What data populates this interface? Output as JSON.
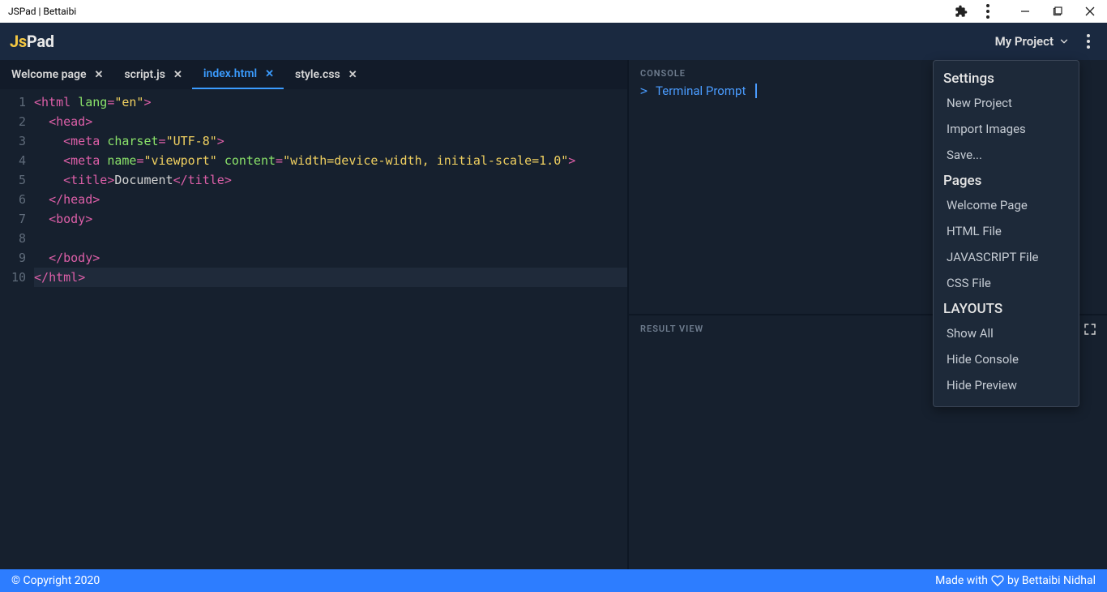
{
  "window": {
    "title": "JSPad | Bettaibi"
  },
  "header": {
    "logo_prefix": "Js",
    "logo_suffix": "Pad",
    "project_label": "My Project"
  },
  "tabs": [
    {
      "label": "Welcome page",
      "active": false
    },
    {
      "label": "script.js",
      "active": false
    },
    {
      "label": "index.html",
      "active": true
    },
    {
      "label": "style.css",
      "active": false
    }
  ],
  "editor": {
    "line_count": 10,
    "current_line_index": 9,
    "lines": [
      {
        "segments": [
          {
            "cls": "t-punc",
            "t": "<"
          },
          {
            "cls": "t-tag",
            "t": "html"
          },
          {
            "cls": "t-text",
            "t": " "
          },
          {
            "cls": "t-attr",
            "t": "lang"
          },
          {
            "cls": "t-punc",
            "t": "="
          },
          {
            "cls": "t-str",
            "t": "\"en\""
          },
          {
            "cls": "t-punc",
            "t": ">"
          }
        ],
        "indent": 0
      },
      {
        "segments": [
          {
            "cls": "t-punc",
            "t": "<"
          },
          {
            "cls": "t-tag",
            "t": "head"
          },
          {
            "cls": "t-punc",
            "t": ">"
          }
        ],
        "indent": 1
      },
      {
        "segments": [
          {
            "cls": "t-punc",
            "t": "<"
          },
          {
            "cls": "t-tag",
            "t": "meta"
          },
          {
            "cls": "t-text",
            "t": " "
          },
          {
            "cls": "t-attr",
            "t": "charset"
          },
          {
            "cls": "t-punc",
            "t": "="
          },
          {
            "cls": "t-str",
            "t": "\"UTF-8\""
          },
          {
            "cls": "t-punc",
            "t": ">"
          }
        ],
        "indent": 2
      },
      {
        "segments": [
          {
            "cls": "t-punc",
            "t": "<"
          },
          {
            "cls": "t-tag",
            "t": "meta"
          },
          {
            "cls": "t-text",
            "t": " "
          },
          {
            "cls": "t-attr",
            "t": "name"
          },
          {
            "cls": "t-punc",
            "t": "="
          },
          {
            "cls": "t-str",
            "t": "\"viewport\""
          },
          {
            "cls": "t-text",
            "t": " "
          },
          {
            "cls": "t-attr",
            "t": "content"
          },
          {
            "cls": "t-punc",
            "t": "="
          },
          {
            "cls": "t-str",
            "t": "\"width=device-width, initial-scale=1.0\""
          },
          {
            "cls": "t-punc",
            "t": ">"
          }
        ],
        "indent": 2
      },
      {
        "segments": [
          {
            "cls": "t-punc",
            "t": "<"
          },
          {
            "cls": "t-tag",
            "t": "title"
          },
          {
            "cls": "t-punc",
            "t": ">"
          },
          {
            "cls": "t-text",
            "t": "Document"
          },
          {
            "cls": "t-punc",
            "t": "</"
          },
          {
            "cls": "t-tag",
            "t": "title"
          },
          {
            "cls": "t-punc",
            "t": ">"
          }
        ],
        "indent": 2
      },
      {
        "segments": [
          {
            "cls": "t-punc",
            "t": "</"
          },
          {
            "cls": "t-tag",
            "t": "head"
          },
          {
            "cls": "t-punc",
            "t": ">"
          }
        ],
        "indent": 1
      },
      {
        "segments": [
          {
            "cls": "t-punc",
            "t": "<"
          },
          {
            "cls": "t-tag",
            "t": "body"
          },
          {
            "cls": "t-punc",
            "t": ">"
          }
        ],
        "indent": 1
      },
      {
        "segments": [],
        "indent": 0
      },
      {
        "segments": [
          {
            "cls": "t-punc",
            "t": "</"
          },
          {
            "cls": "t-tag",
            "t": "body"
          },
          {
            "cls": "t-punc",
            "t": ">"
          }
        ],
        "indent": 1
      },
      {
        "segments": [
          {
            "cls": "t-punc",
            "t": "</"
          },
          {
            "cls": "t-tag",
            "t": "html"
          },
          {
            "cls": "t-punc",
            "t": ">"
          }
        ],
        "indent": 0
      }
    ]
  },
  "console": {
    "label": "CONSOLE",
    "prompt_symbol": ">",
    "prompt_text": "Terminal Prompt"
  },
  "result": {
    "label": "RESULT VIEW"
  },
  "menu": {
    "sections": [
      {
        "heading": "Settings",
        "items": [
          "New Project",
          "Import Images",
          "Save..."
        ]
      },
      {
        "heading": "Pages",
        "items": [
          "Welcome Page",
          "HTML File",
          "JAVASCRIPT File",
          "CSS File"
        ]
      },
      {
        "heading": "LAYOUTS",
        "items": [
          "Show All",
          "Hide Console",
          "Hide Preview"
        ]
      }
    ]
  },
  "footer": {
    "copyright": "© Copyright 2020",
    "made_with_prefix": "Made with",
    "made_with_suffix": "by Bettaibi Nidhal"
  }
}
